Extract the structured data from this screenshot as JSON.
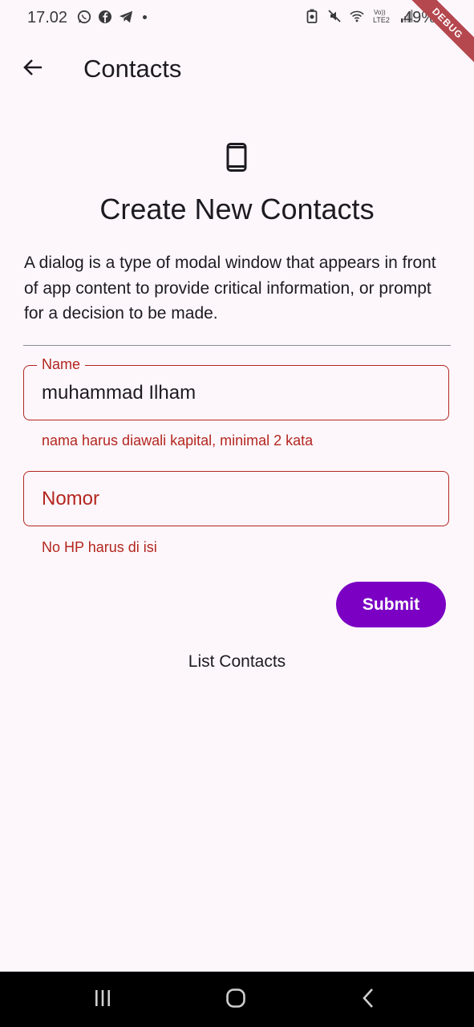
{
  "status_bar": {
    "time": "17.02",
    "battery": "49%",
    "icons_left": [
      "whatsapp-icon",
      "facebook-icon",
      "telegram-icon",
      "dot-icon"
    ],
    "icons_right": [
      "battery-saver-icon",
      "mute-icon",
      "wifi-icon",
      "volte-icon",
      "signal-icon"
    ],
    "volte_text": "Vo)) LTE2",
    "debug_label": "DEBUG"
  },
  "app_bar": {
    "title": "Contacts",
    "back_icon": "arrow-back-icon"
  },
  "content": {
    "icon": "smartphone-icon",
    "heading": "Create New Contacts",
    "description": "A dialog is a type of modal window that appears in front of app content to provide critical information, or prompt for a decision to be made.",
    "name_field": {
      "label": "Name",
      "value": "muhammad Ilham",
      "error": "nama harus diawali kapital, minimal 2 kata"
    },
    "nomor_field": {
      "placeholder": "Nomor",
      "value": "",
      "error": "No HP harus di isi"
    },
    "submit_label": "Submit",
    "list_title": "List Contacts"
  },
  "colors": {
    "background": "#fdf7fc",
    "error": "#b3261e",
    "primary_button": "#7b00c4",
    "nav_bar": "#000000"
  },
  "nav_bar": {
    "buttons": [
      "recents-icon",
      "home-icon",
      "back-icon"
    ]
  }
}
